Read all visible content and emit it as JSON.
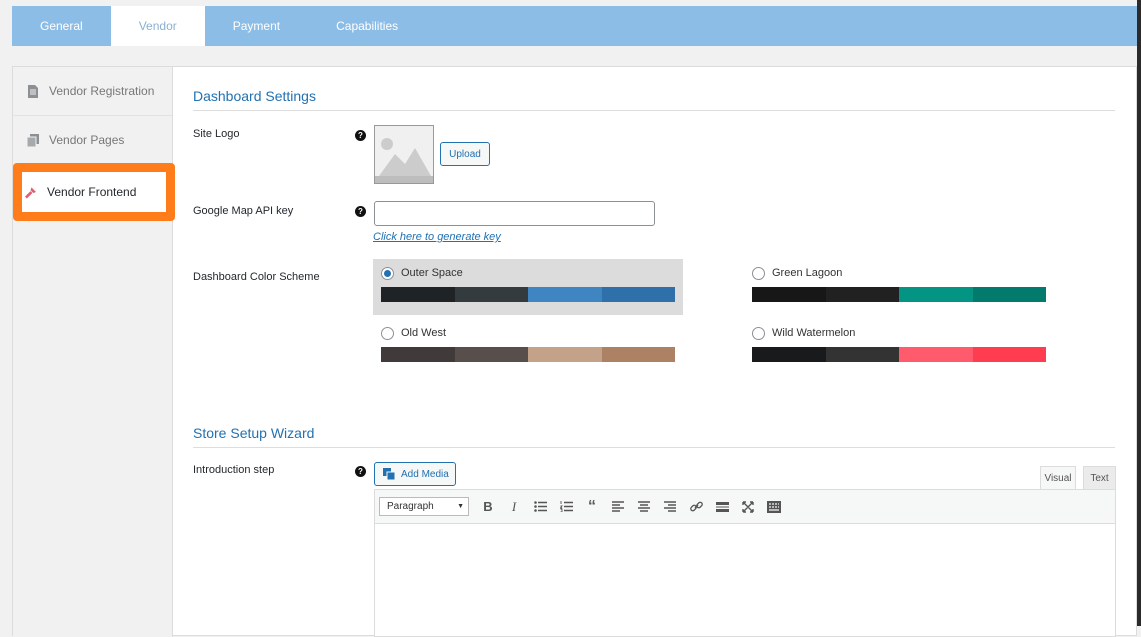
{
  "tabs": [
    {
      "label": "General",
      "active": false
    },
    {
      "label": "Vendor",
      "active": true
    },
    {
      "label": "Payment",
      "active": false
    },
    {
      "label": "Capabilities",
      "active": false
    }
  ],
  "sidebar": {
    "items": [
      {
        "label": "Vendor Registration",
        "icon": "document-icon"
      },
      {
        "label": "Vendor Pages",
        "icon": "pages-icon"
      },
      {
        "label": "Vendor Frontend",
        "icon": "brush-icon",
        "active": true
      }
    ]
  },
  "dashboard": {
    "title": "Dashboard Settings",
    "site_logo_label": "Site Logo",
    "upload_label": "Upload",
    "gmap_label": "Google Map API key",
    "gmap_value": "",
    "gmap_link": "Click here to generate key",
    "color_scheme_label": "Dashboard Color Scheme",
    "schemes": [
      {
        "name": "Outer Space",
        "selected": true,
        "colors": [
          "#202326",
          "#333b3e",
          "#3f85c2",
          "#2f6faa"
        ]
      },
      {
        "name": "Green Lagoon",
        "selected": false,
        "colors": [
          "#171717",
          "#212121",
          "#049483",
          "#027a6c"
        ]
      },
      {
        "name": "Old West",
        "selected": false,
        "colors": [
          "#403b3a",
          "#584f4c",
          "#c4a189",
          "#ad8163"
        ]
      },
      {
        "name": "Wild Watermelon",
        "selected": false,
        "colors": [
          "#181a1c",
          "#333333",
          "#ff5b6c",
          "#ff3c50"
        ]
      }
    ]
  },
  "wizard": {
    "title": "Store Setup Wizard",
    "intro_label": "Introduction step",
    "add_media_label": "Add Media",
    "editor_tabs": {
      "visual": "Visual",
      "text": "Text"
    },
    "format_value": "Paragraph"
  },
  "help_glyph": "?"
}
